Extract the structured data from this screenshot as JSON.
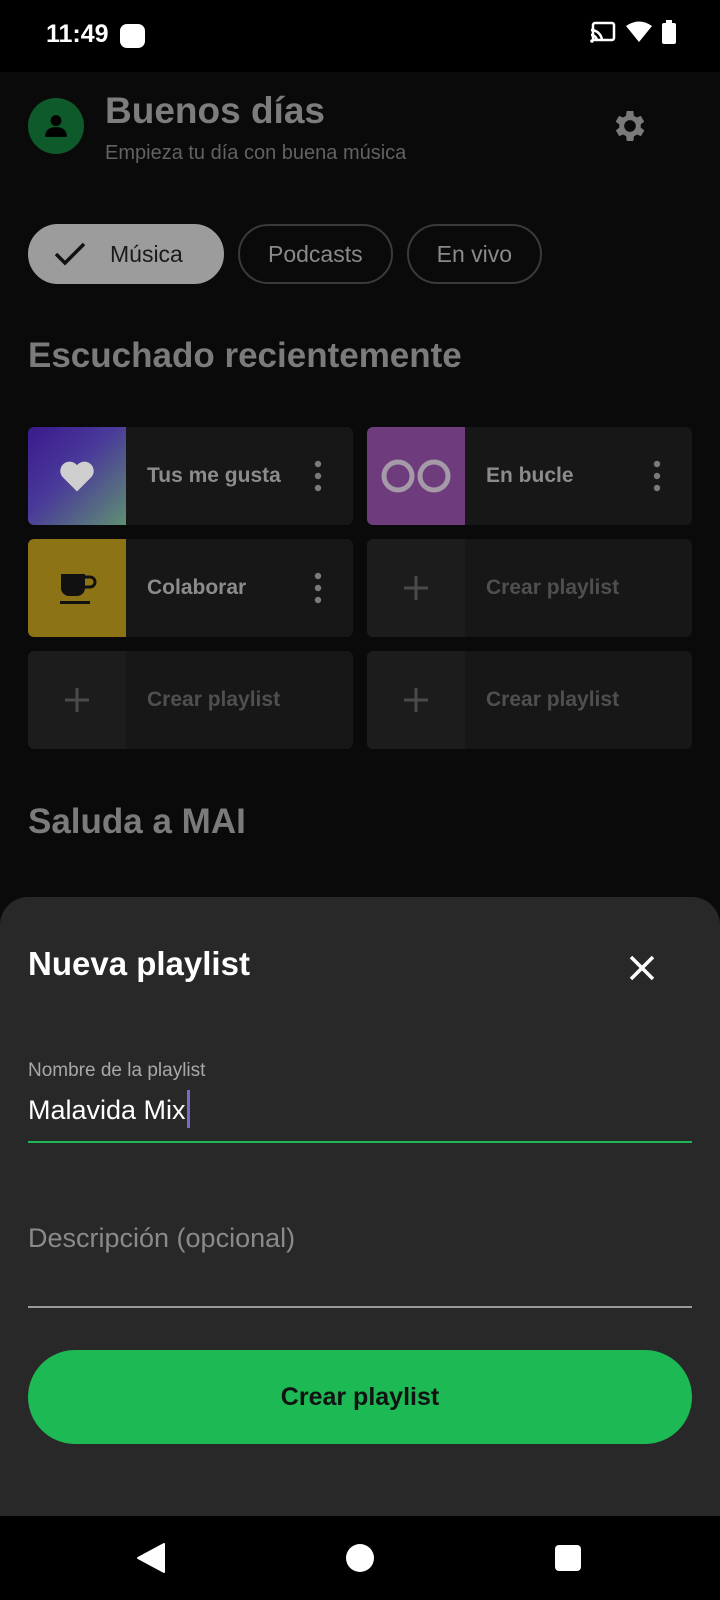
{
  "status_bar": {
    "time": "11:49",
    "icons": [
      "cast-icon",
      "wifi-icon",
      "battery-icon"
    ]
  },
  "header": {
    "greeting": "Buenos días",
    "subtitle": "Empieza tu día con buena música",
    "avatar_icon": "person-icon",
    "settings_icon": "gear-icon"
  },
  "filters": [
    {
      "label": "Música",
      "selected": true
    },
    {
      "label": "Podcasts",
      "selected": false
    },
    {
      "label": "En vivo",
      "selected": false
    }
  ],
  "recent": {
    "title": "Escuchado recientemente",
    "items": [
      {
        "label": "Tus me gusta",
        "thumb": "heart-icon"
      },
      {
        "label": "En bucle",
        "thumb": "loop-icon"
      },
      {
        "label": "Colaborar",
        "thumb": "cup-icon"
      },
      {
        "label": "Crear playlist",
        "thumb": "plus-icon"
      },
      {
        "label": "Crear playlist",
        "thumb": "plus-icon"
      },
      {
        "label": "Crear playlist",
        "thumb": "plus-icon"
      }
    ]
  },
  "mai": {
    "title": "Saluda a MAI"
  },
  "sheet": {
    "title": "Nueva playlist",
    "name_label": "Nombre de la playlist",
    "name_value": "Malavida Mix",
    "description_placeholder": "Descripción (opcional)",
    "create_label": "Crear playlist"
  },
  "colors": {
    "accent": "#1db954",
    "sheet_bg": "#282828",
    "background": "#0a0a0a"
  }
}
